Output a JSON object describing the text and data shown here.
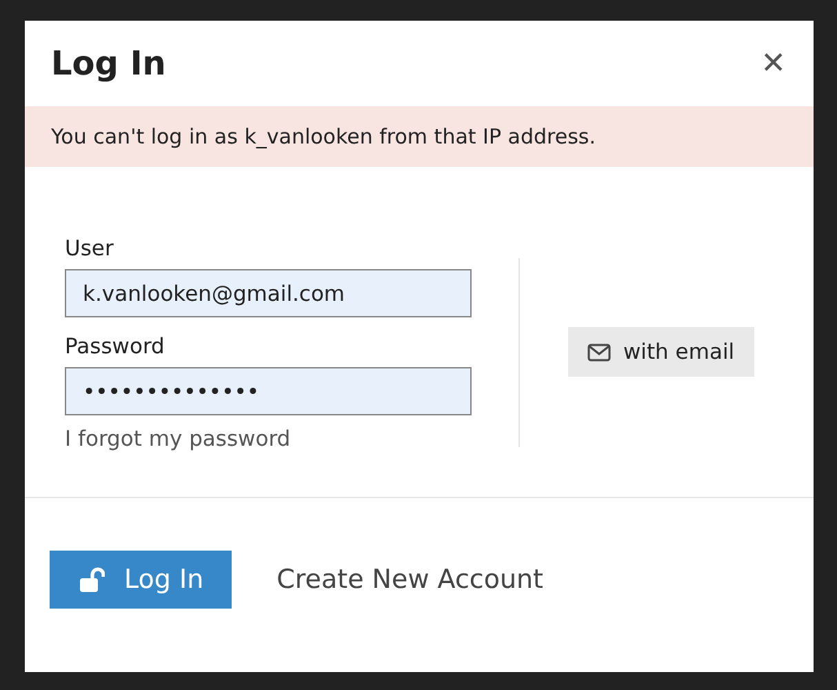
{
  "dialog": {
    "title": "Log In",
    "close": "✕"
  },
  "alert": {
    "message": "You can't log in as k_vanlooken from that IP address."
  },
  "form": {
    "user_label": "User",
    "user_value": "k.vanlooken@gmail.com",
    "password_label": "Password",
    "password_value": "••••••••••••••",
    "forgot_link": "I forgot my password"
  },
  "email_button": {
    "label": "with email"
  },
  "footer": {
    "login_button": "Log In",
    "create_account": "Create New Account"
  }
}
